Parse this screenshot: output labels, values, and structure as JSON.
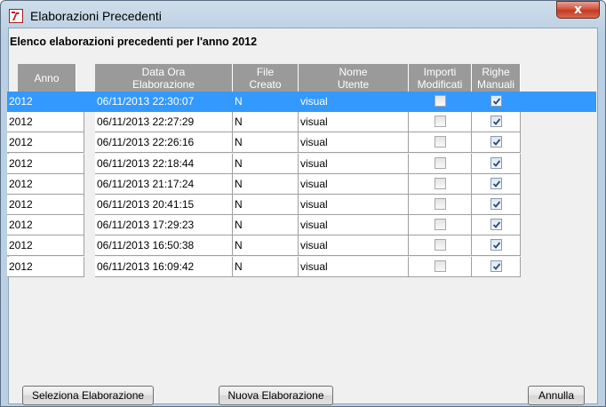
{
  "window": {
    "title": "Elaborazioni Precedenti",
    "close_label": "x"
  },
  "heading": "Elenco elaborazioni precedenti per l'anno 2012",
  "columns": [
    {
      "line1": "Anno",
      "line2": ""
    },
    {
      "line1": "Data Ora",
      "line2": "Elaborazione"
    },
    {
      "line1": "File",
      "line2": "Creato"
    },
    {
      "line1": "Nome",
      "line2": "Utente"
    },
    {
      "line1": "Importi",
      "line2": "Modificati"
    },
    {
      "line1": "Righe",
      "line2": "Manuali"
    }
  ],
  "rows": [
    {
      "anno": "2012",
      "data_ora": "06/11/2013 22:30:07",
      "file_creato": "N",
      "nome_utente": "visual",
      "importi_modificati": false,
      "righe_manuali": true,
      "selected": true
    },
    {
      "anno": "2012",
      "data_ora": "06/11/2013 22:27:29",
      "file_creato": "N",
      "nome_utente": "visual",
      "importi_modificati": false,
      "righe_manuali": true,
      "selected": false
    },
    {
      "anno": "2012",
      "data_ora": "06/11/2013 22:26:16",
      "file_creato": "N",
      "nome_utente": "visual",
      "importi_modificati": false,
      "righe_manuali": true,
      "selected": false
    },
    {
      "anno": "2012",
      "data_ora": "06/11/2013 22:18:44",
      "file_creato": "N",
      "nome_utente": "visual",
      "importi_modificati": false,
      "righe_manuali": true,
      "selected": false
    },
    {
      "anno": "2012",
      "data_ora": "06/11/2013 21:17:24",
      "file_creato": "N",
      "nome_utente": "visual",
      "importi_modificati": false,
      "righe_manuali": true,
      "selected": false
    },
    {
      "anno": "2012",
      "data_ora": "06/11/2013 20:41:15",
      "file_creato": "N",
      "nome_utente": "visual",
      "importi_modificati": false,
      "righe_manuali": true,
      "selected": false
    },
    {
      "anno": "2012",
      "data_ora": "06/11/2013 17:29:23",
      "file_creato": "N",
      "nome_utente": "visual",
      "importi_modificati": false,
      "righe_manuali": true,
      "selected": false
    },
    {
      "anno": "2012",
      "data_ora": "06/11/2013 16:50:38",
      "file_creato": "N",
      "nome_utente": "visual",
      "importi_modificati": false,
      "righe_manuali": true,
      "selected": false
    },
    {
      "anno": "2012",
      "data_ora": "06/11/2013 16:09:42",
      "file_creato": "N",
      "nome_utente": "visual",
      "importi_modificati": false,
      "righe_manuali": true,
      "selected": false
    }
  ],
  "buttons": {
    "seleziona": "Seleziona Elaborazione",
    "nuova": "Nuova Elaborazione",
    "annulla": "Annulla"
  },
  "colors": {
    "selection": "#3399ff",
    "header_bg": "#9a9a9a"
  }
}
